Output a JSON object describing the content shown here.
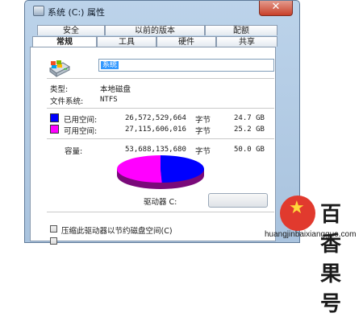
{
  "window": {
    "title": "系统 (C:) 属性",
    "close_glyph": "✕"
  },
  "tabs_row1": [
    "安全",
    "以前的版本",
    "配额"
  ],
  "tabs_row2": [
    "常规",
    "工具",
    "硬件",
    "共享"
  ],
  "active_tab": "常规",
  "general": {
    "name_value": "系统",
    "type_label": "类型:",
    "type_value": "本地磁盘",
    "fs_label": "文件系统:",
    "fs_value": "NTFS",
    "used_label": "已用空间:",
    "used_bytes": "26,572,529,664",
    "used_unit": "字节",
    "used_size": "24.7 GB",
    "free_label": "可用空间:",
    "free_bytes": "27,115,606,016",
    "free_unit": "字节",
    "free_size": "25.2 GB",
    "capacity_label": "容量:",
    "capacity_bytes": "53,688,135,680",
    "capacity_unit": "字节",
    "capacity_size": "50.0 GB",
    "drive_label": "驱动器 C:",
    "compress_label": "压缩此驱动器以节约磁盘空间(C)",
    "used_fraction": 0.495
  },
  "colors": {
    "used": "#0000ff",
    "free": "#ff00ff",
    "accent_selection": "#3399ff"
  },
  "watermark": {
    "brand": "百香果号",
    "url": "huangjinbaixiangguo.com"
  }
}
